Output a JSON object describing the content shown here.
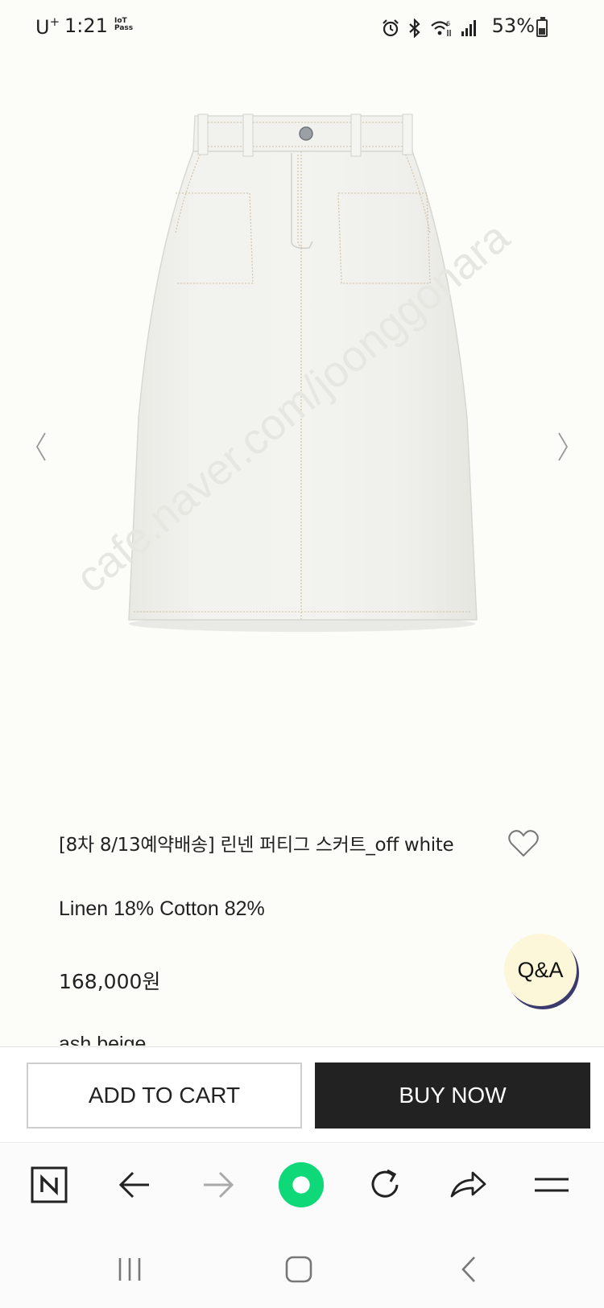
{
  "status_bar": {
    "carrier": "U",
    "carrier_sup": "+",
    "time": "1:21",
    "iot_line1": "IoT",
    "iot_line2": "Pass",
    "battery": "53%",
    "battery_level": 0.53
  },
  "product": {
    "title": "[8차 8/13예약배송] 린넨 퍼티그 스커트_off white",
    "material": "Linen 18% Cotton 82%",
    "price": "168,000원",
    "color_option": "ash beige",
    "image_alt": "off white skirt",
    "watermark": "cafe.naver.com/joonggonara"
  },
  "qa_label": "Q&A",
  "purchase": {
    "add_to_cart": "ADD TO CART",
    "buy_now": "BUY NOW"
  },
  "toolbar_icons": [
    "naver-icon",
    "back-icon",
    "forward-icon",
    "home-icon",
    "refresh-icon",
    "share-icon",
    "menu-icon"
  ],
  "colors": {
    "accent_green": "#0fd878",
    "buy_now_bg": "#222222",
    "qa_bg": "#fdf7d9",
    "page_bg": "#fcfcf9"
  }
}
